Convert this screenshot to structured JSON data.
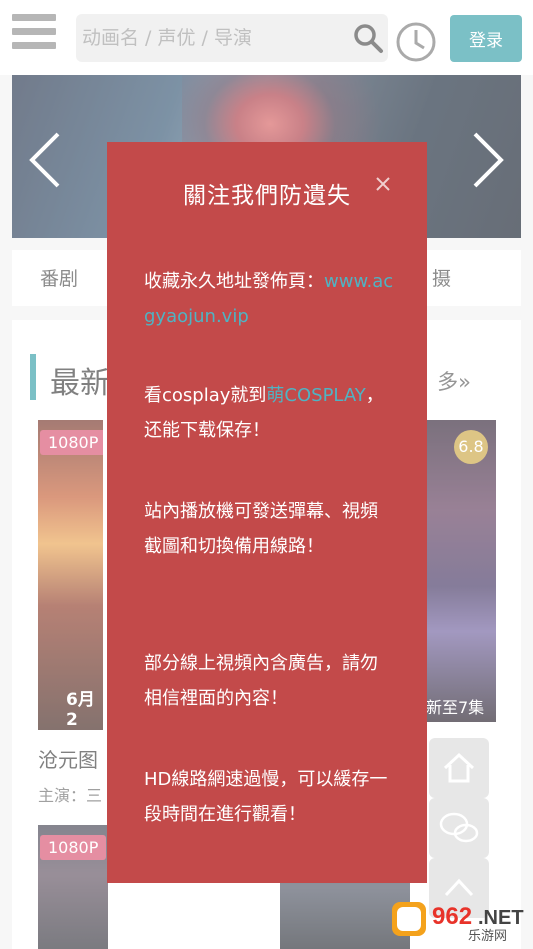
{
  "header": {
    "search_placeholder": "动画名 / 声优 / 导演",
    "login_label": "登录"
  },
  "categories": [
    "番剧",
    "摄"
  ],
  "section": {
    "title": "最新",
    "more": "多»"
  },
  "cards": [
    {
      "resolution": "1080P",
      "date": "6月2",
      "title": "沧元图",
      "cast": "主演：三"
    },
    {
      "score": "6.8",
      "episode": "新至7集"
    },
    {
      "resolution": "1080P"
    }
  ],
  "modal": {
    "title": "關注我們防遺失",
    "p1_text": "收藏永久地址發佈頁：",
    "p1_link": "www.acgyaojun.vip",
    "p2_text_before": "看cosplay就到",
    "p2_link": "萌COSPLAY",
    "p2_text_after": "，还能下载保存！",
    "p3": "站內播放機可發送彈幕、視頻截圖和切換備用線路！",
    "p4": "部分線上視頻內含廣告，請勿相信裡面的內容！",
    "p5": "HD線路網速過慢，可以緩存一段時間在進行觀看！"
  },
  "watermark": {
    "brand": "962.NET",
    "sub": "乐游网"
  },
  "colors": {
    "accent": "#2a9aa3",
    "modal_bg": "#c34a4a",
    "link": "#4fb3c3",
    "badge": "#d64a6a"
  }
}
